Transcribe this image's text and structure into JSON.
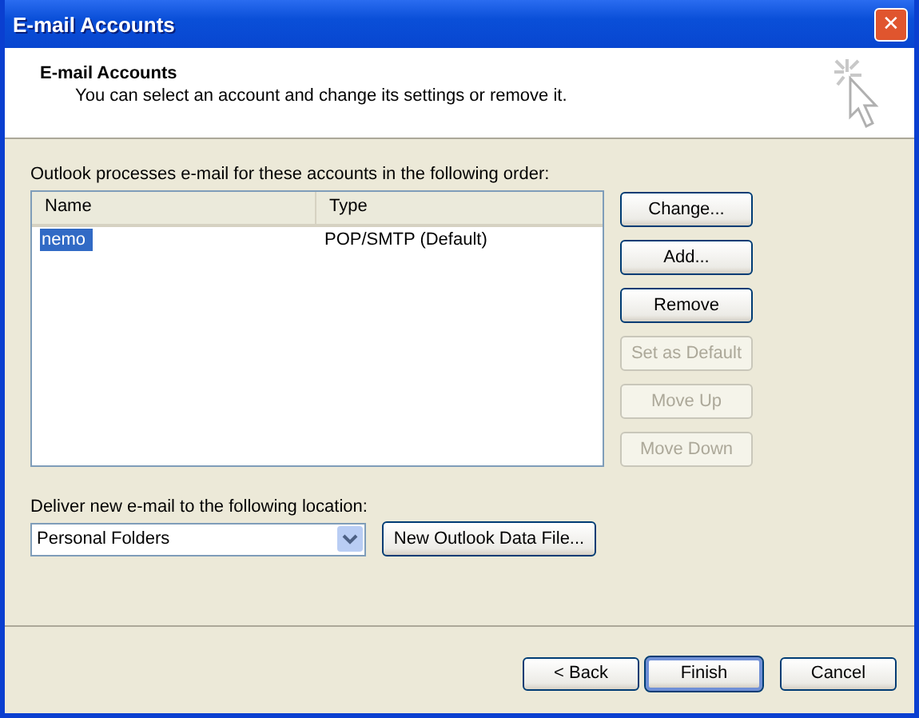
{
  "window": {
    "title": "E-mail Accounts",
    "close": "✕"
  },
  "header": {
    "title": "E-mail Accounts",
    "subtitle": "You can select an account and change its settings or remove it."
  },
  "accounts": {
    "label": "Outlook processes e-mail for these accounts in the following order:",
    "columns": [
      "Name",
      "Type"
    ],
    "rows": [
      {
        "name": "nemo",
        "type": "POP/SMTP (Default)",
        "selected": true
      }
    ]
  },
  "account_buttons": [
    {
      "label": "Change...",
      "disabled": false
    },
    {
      "label": "Add...",
      "disabled": false
    },
    {
      "label": "Remove",
      "disabled": false
    },
    {
      "label": "Set as Default",
      "disabled": true
    },
    {
      "label": "Move Up",
      "disabled": true
    },
    {
      "label": "Move Down",
      "disabled": true
    }
  ],
  "delivery": {
    "label": "Deliver new e-mail to the following location:",
    "value": "Personal Folders",
    "button": "New Outlook Data File..."
  },
  "footer_buttons": [
    {
      "label": "< Back",
      "default": false
    },
    {
      "label": "Finish",
      "default": true
    },
    {
      "label": "Cancel",
      "default": false
    }
  ]
}
